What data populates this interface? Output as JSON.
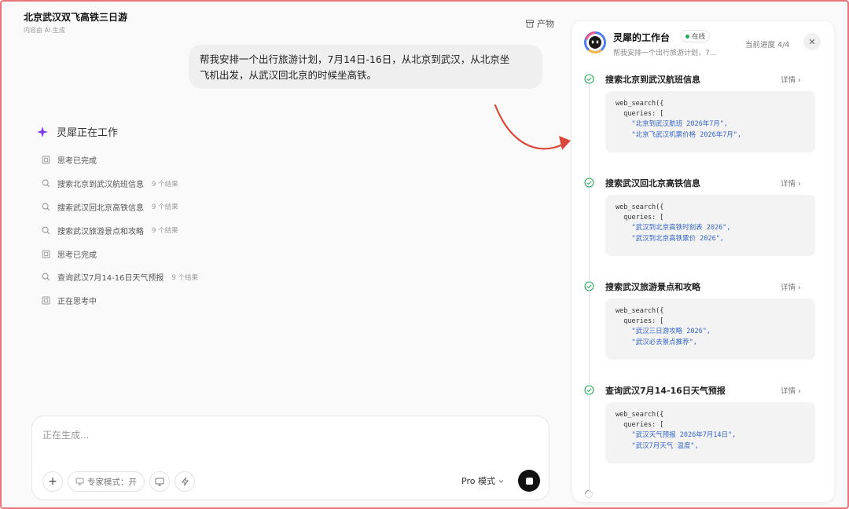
{
  "header": {
    "title": "北京武汉双飞高铁三日游",
    "subtitle": "内容由 AI 生成",
    "artifacts_label": "产物"
  },
  "user_message": {
    "line1": "帮我安排一个出行旅游计划，7月14日-16日，从北京到武汉，从北京坐",
    "line2": "飞机出发，从武汉回北京的时候坐高铁。"
  },
  "agent": {
    "working_label": "灵犀正在工作",
    "steps": [
      {
        "type": "think",
        "label": "思考已完成",
        "count": ""
      },
      {
        "type": "search",
        "label": "搜索北京到武汉航班信息",
        "count": "9 个结果"
      },
      {
        "type": "search",
        "label": "搜索武汉回北京高铁信息",
        "count": "9 个结果"
      },
      {
        "type": "search",
        "label": "搜索武汉旅游景点和攻略",
        "count": "9 个结果"
      },
      {
        "type": "think",
        "label": "思考已完成",
        "count": ""
      },
      {
        "type": "search",
        "label": "查询武汉7月14-16日天气预报",
        "count": "9 个结果"
      },
      {
        "type": "think",
        "label": "正在思考中",
        "count": ""
      }
    ]
  },
  "input": {
    "placeholder": "正在生成...",
    "expert_mode_label": "专家模式：开",
    "mode_label": "Pro 模式"
  },
  "panel": {
    "title": "灵犀的工作台",
    "online_label": "在线",
    "subtitle": "帮我安排一个出行旅游计划，7...",
    "progress": "当前进度 4/4",
    "cards": [
      {
        "name": "搜索北京到武汉航班信息",
        "detail": "详情",
        "fn": "web_search({",
        "queries": "queries: [",
        "q1": "\"北京到武汉航班 2026年7月\",",
        "q2": "\"北京飞武汉机票价格 2026年7月\","
      },
      {
        "name": "搜索武汉回北京高铁信息",
        "detail": "详情",
        "fn": "web_search({",
        "queries": "queries: [",
        "q1": "\"武汉到北京高铁时刻表 2026\",",
        "q2": "\"武汉到北京高铁票价 2026\","
      },
      {
        "name": "搜索武汉旅游景点和攻略",
        "detail": "详情",
        "fn": "web_search({",
        "queries": "queries: [",
        "q1": "\"武汉三日游攻略 2026\",",
        "q2": "\"武汉必去景点推荐\","
      },
      {
        "name": "查询武汉7月14-16日天气预报",
        "detail": "详情",
        "fn": "web_search({",
        "queries": "queries: [",
        "q1": "\"武汉天气预报 2026年7月14日\",",
        "q2": "\"武汉7月天气 温度\","
      }
    ]
  },
  "colors": {
    "accent_red": "#e8747c",
    "arrow": "#d9483b",
    "check_green": "#27a95a",
    "code_string": "#3464c8"
  }
}
